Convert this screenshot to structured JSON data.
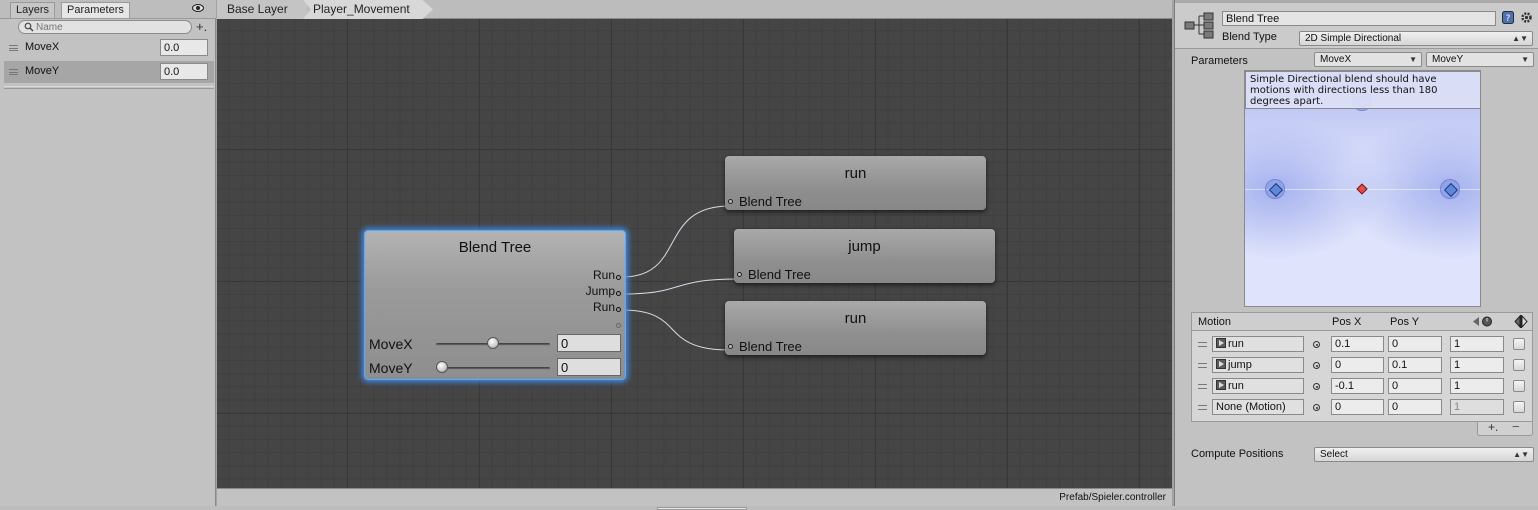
{
  "left_panel": {
    "tabs": [
      "Layers",
      "Parameters"
    ],
    "search_placeholder": "Name",
    "add_symbol": "+.",
    "parameters": [
      {
        "name": "MoveX",
        "value": "0.0"
      },
      {
        "name": "MoveY",
        "value": "0.0"
      }
    ]
  },
  "graph": {
    "breadcrumbs": [
      "Base Layer",
      "Player_Movement"
    ],
    "status_path": "Prefab/Spieler.controller",
    "blend_tree_node": {
      "title": "Blend Tree",
      "outputs": [
        "Run",
        "Jump",
        "Run"
      ],
      "sliders": [
        {
          "name": "MoveX",
          "value": "0",
          "level": 0.5
        },
        {
          "name": "MoveY",
          "value": "0",
          "level": 0.0
        }
      ]
    },
    "motion_nodes": [
      {
        "title": "run",
        "port_label": "Blend Tree"
      },
      {
        "title": "jump",
        "port_label": "Blend Tree"
      },
      {
        "title": "run",
        "port_label": "Blend Tree"
      }
    ]
  },
  "inspector": {
    "name": "Blend Tree",
    "blend_type_label": "Blend Type",
    "blend_type_value": "2D Simple Directional",
    "parameters_label": "Parameters",
    "param_x": "MoveX",
    "param_y": "MoveY",
    "warning": "Simple Directional blend should have motions with directions less than 180 degrees apart.",
    "table_headers": {
      "motion": "Motion",
      "pos_x": "Pos X",
      "pos_y": "Pos Y"
    },
    "motions": [
      {
        "motion": "run",
        "pos_x": "0.1",
        "pos_y": "0",
        "speed": "1",
        "has_clip": true,
        "enabled": true
      },
      {
        "motion": "jump",
        "pos_x": "0",
        "pos_y": "0.1",
        "speed": "1",
        "has_clip": true,
        "enabled": true
      },
      {
        "motion": "run",
        "pos_x": "-0.1",
        "pos_y": "0",
        "speed": "1",
        "has_clip": true,
        "enabled": true
      },
      {
        "motion": "None (Motion)",
        "pos_x": "0",
        "pos_y": "0",
        "speed": "1",
        "has_clip": false,
        "enabled": false
      }
    ],
    "add_symbol": "+.",
    "remove_symbol": "−",
    "compute_label": "Compute Positions",
    "compute_value": "Select"
  },
  "icons": {
    "eye": "eye-icon",
    "search": "search-icon",
    "gear": "gear-icon",
    "help": "help-icon",
    "blend_tree": "blend-tree-icon",
    "clip": "animation-clip-icon"
  },
  "colors": {
    "selection_glow": "#3d8ce8",
    "graph_background": "#454545",
    "current_position": "#e84c4c",
    "motion_point": "#5e88d8"
  }
}
